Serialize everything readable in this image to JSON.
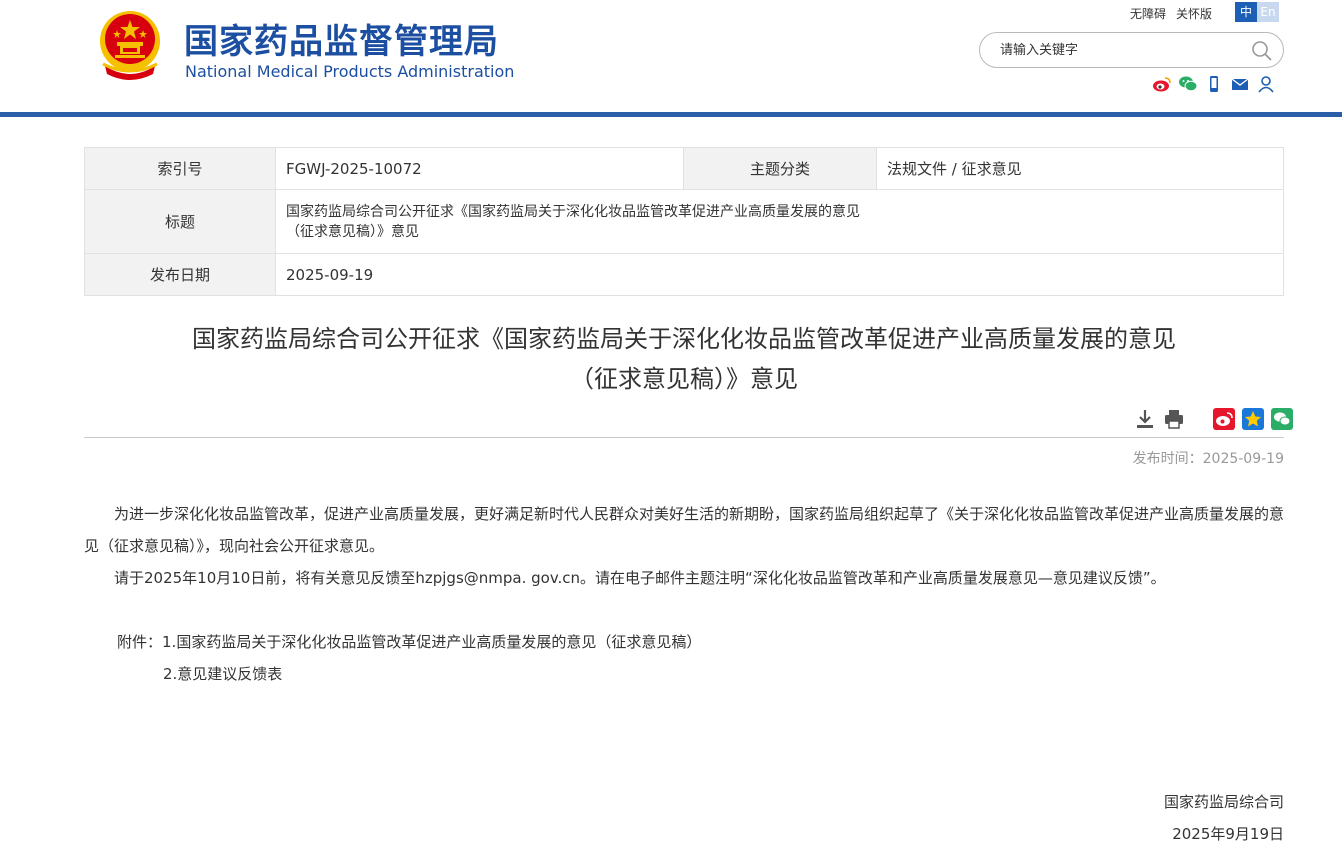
{
  "header": {
    "logo_cn": "国家药品监督管理局",
    "logo_en": "National Medical Products Administration",
    "links": {
      "accessibility": "无障碍",
      "elder_mode": "关怀版"
    },
    "lang": {
      "zh": "中",
      "en": "En"
    },
    "search_placeholder": "请输入关键字",
    "social_icons": [
      "weibo-icon",
      "wechat-icon",
      "mobile-icon",
      "mail-icon",
      "user-icon"
    ],
    "colors": {
      "brand_blue": "#1c4fa1",
      "bar_blue": "#2a5ea8",
      "emblem_red": "#d7000f",
      "emblem_gold": "#f5c000"
    }
  },
  "meta": {
    "index_label": "索引号",
    "index_value": "FGWJ-2025-10072",
    "topic_label": "主题分类",
    "topic_value": "法规文件 / 征求意见",
    "title_label": "标题",
    "title_value_line1": "国家药监局综合司公开征求《国家药监局关于深化化妆品监管改革促进产业高质量发展的意见",
    "title_value_line2": "（征求意见稿）》意见",
    "date_label": "发布日期",
    "date_value": "2025-09-19"
  },
  "article": {
    "title_line1": "国家药监局综合司公开征求《国家药监局关于深化化妆品监管改革促进产业高质量发展的意见",
    "title_line2": "（征求意见稿）》意见",
    "tools": [
      "download-icon",
      "print-icon",
      "share-weibo-icon",
      "share-qzone-icon",
      "share-wechat-icon"
    ],
    "pub_time": "发布时间：2025-09-19",
    "para1": "为进一步深化化妆品监管改革，促进产业高质量发展，更好满足新时代人民群众对美好生活的新期盼，国家药监局组织起草了《关于深化化妆品监管改革促进产业高质量发展的意见（征求意见稿）》，现向社会公开征求意见。",
    "para2": "请于2025年10月10日前，将有关意见反馈至hzpjgs@nmpa. gov.cn。请在电子邮件主题注明“深化化妆品监管改革和产业高质量发展意见—意见建议反馈”。",
    "attach_prefix": "附件：",
    "attach1": "1.国家药监局关于深化化妆品监管改革促进产业高质量发展的意见（征求意见稿）",
    "attach2": "2.意见建议反馈表",
    "sign_org": "国家药监局综合司",
    "sign_date": "2025年9月19日"
  }
}
